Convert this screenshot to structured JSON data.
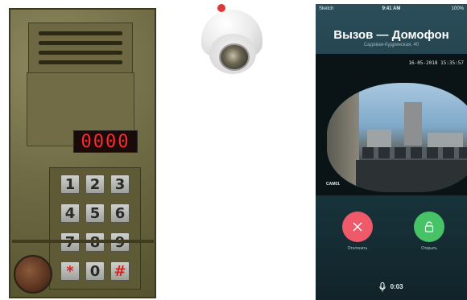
{
  "intercom": {
    "display_code": "0000",
    "keys": [
      "1",
      "2",
      "3",
      "4",
      "5",
      "6",
      "7",
      "8",
      "9",
      "*",
      "0",
      "#"
    ]
  },
  "camera": {
    "color": "#ececec",
    "icon": "dome-camera-icon"
  },
  "phone": {
    "status": {
      "carrier": "Sketch",
      "time": "9:41 AM",
      "battery": "100%"
    },
    "call": {
      "title": "Вызов — Домофон",
      "subtitle": "Садовая-Кудринская, 40",
      "timestamp": "16-05-2018 15:35:57",
      "camera_label": "CAM01",
      "decline_label": "Отклонить",
      "open_label": "Открыть",
      "duration": "0:03",
      "decline_color": "#ef5a6a",
      "open_color": "#47c267"
    }
  }
}
